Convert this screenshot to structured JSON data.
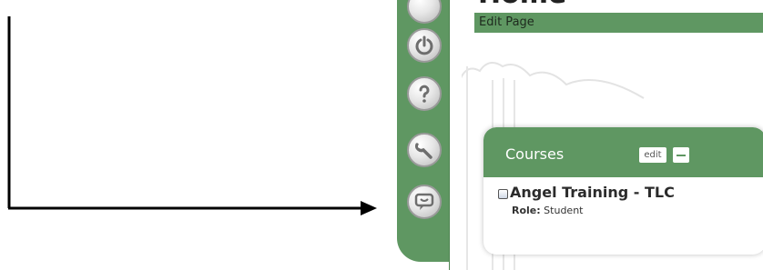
{
  "page": {
    "title": "Home",
    "edit_page_label": "Edit Page"
  },
  "rail": {
    "icons": [
      "power-icon",
      "help-icon",
      "tools-icon",
      "chat-icon"
    ]
  },
  "courses_panel": {
    "title": "Courses",
    "edit_label": "edit",
    "course": {
      "name": "Angel Training - TLC",
      "role_label": "Role:",
      "role_value": "Student"
    }
  },
  "colors": {
    "accent_green": "#5f9762",
    "annotation": "#000000"
  }
}
